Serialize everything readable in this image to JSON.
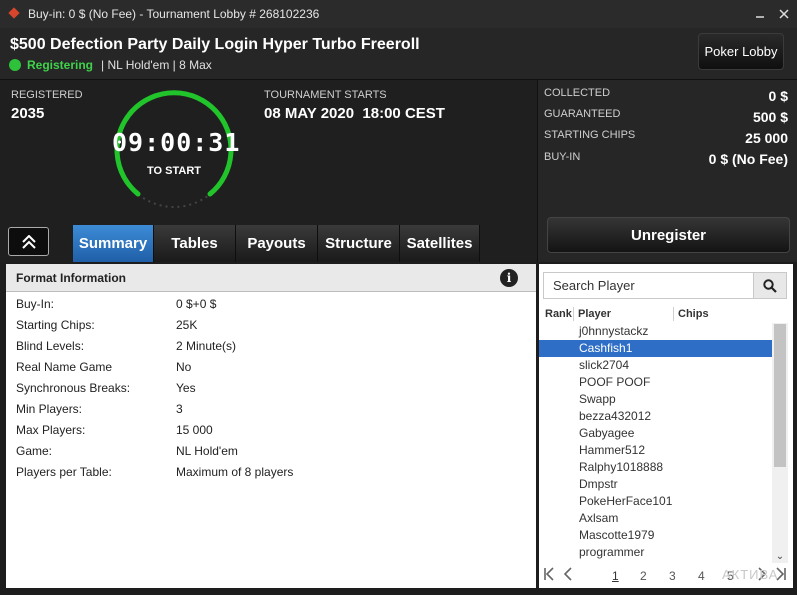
{
  "window": {
    "title": "Buy-in: 0 $ (No Fee) - Tournament Lobby # 268102236"
  },
  "header": {
    "tournament_name": "$500 Defection Party Daily Login Hyper Turbo Freeroll",
    "status": "Registering",
    "meta": "| NL Hold'em | 8 Max",
    "lobby_button": "Poker Lobby"
  },
  "info": {
    "registered_label": "REGISTERED",
    "registered_value": "2035",
    "timer": "09:00:31",
    "timer_sub": "TO START",
    "starts_label": "TOURNAMENT STARTS",
    "starts_value": "08 MAY 2020  18:00 CEST"
  },
  "stats": {
    "collected_label": "COLLECTED",
    "collected_value": "0 $",
    "guaranteed_label": "GUARANTEED",
    "guaranteed_value": "500 $",
    "chips_label": "STARTING CHIPS",
    "chips_value": "25 000",
    "buyin_label": "BUY-IN",
    "buyin_value": "0 $ (No Fee)",
    "unregister_button": "Unregister"
  },
  "tabs": [
    "Summary",
    "Tables",
    "Payouts",
    "Structure",
    "Satellites"
  ],
  "format": {
    "heading": "Format Information",
    "rows": [
      {
        "label": "Buy-In:",
        "value": "0 $+0 $"
      },
      {
        "label": "Starting Chips:",
        "value": "25K"
      },
      {
        "label": "Blind Levels:",
        "value": "2 Minute(s)"
      },
      {
        "label": "Real Name Game",
        "value": "No"
      },
      {
        "label": "Synchronous Breaks:",
        "value": "Yes"
      },
      {
        "label": "Min Players:",
        "value": "3"
      },
      {
        "label": "Max Players:",
        "value": "15 000"
      },
      {
        "label": "Game:",
        "value": "NL Hold'em"
      },
      {
        "label": "Players per Table:",
        "value": "Maximum of 8 players"
      }
    ]
  },
  "players": {
    "search_placeholder": "Search Player",
    "col_rank": "Rank",
    "col_player": "Player",
    "col_chips": "Chips",
    "list": [
      "j0hnnystackz",
      "Cashfish1",
      "slick2704",
      "POOF POOF",
      "Swapp",
      "bezza432012",
      "Gabyagee",
      "Hammer512",
      "Ralphy1018888",
      "Dmpstr",
      "PokeHerFace101",
      "Axlsam",
      "Mascotte1979",
      "programmer"
    ],
    "selected_index": 1,
    "pages": [
      "1",
      "2",
      "3",
      "4",
      "5"
    ],
    "watermark": "АКТИВА"
  },
  "colors": {
    "accent": "#2f6ec6",
    "status_green": "#3fd24b",
    "tab_active": "#2d74c2"
  }
}
